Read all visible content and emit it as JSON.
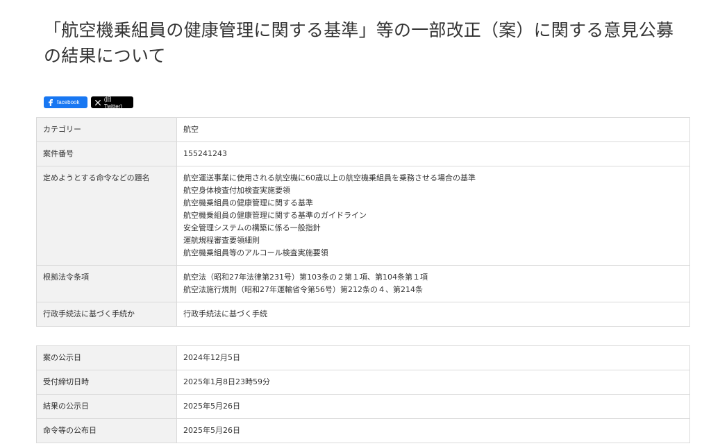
{
  "page": {
    "title": "「航空機乗組員の健康管理に関する基準」等の一部改正（案）に関する意見公募の結果について"
  },
  "share": {
    "facebook_label": "facebook",
    "x_label": "(旧Twitter)"
  },
  "details": {
    "category_label": "カテゴリー",
    "category_value": "航空",
    "case_number_label": "案件番号",
    "case_number_value": "155241243",
    "order_title_label": "定めようとする命令などの題名",
    "order_titles": [
      "航空運送事業に使用される航空機に60歳以上の航空機乗組員を乗務させる場合の基準",
      "航空身体検査付加検査実施要領",
      "航空機乗組員の健康管理に関する基準",
      "航空機乗組員の健康管理に関する基準のガイドライン",
      "安全管理システムの構築に係る一般指針",
      "運航規程審査要領細則",
      "航空機乗組員等のアルコール検査実施要領"
    ],
    "legal_basis_label": "根拠法令条項",
    "legal_basis": [
      "航空法（昭和27年法律第231号）第103条の２第１項、第104条第１項",
      "航空法施行規則（昭和27年運輸省令第56号）第212条の４、第214条"
    ],
    "procedure_label": "行政手続法に基づく手続か",
    "procedure_value": "行政手続法に基づく手続"
  },
  "dates": {
    "announce_label": "案の公示日",
    "announce_value": "2024年12月5日",
    "deadline_label": "受付締切日時",
    "deadline_value": "2025年1月8日23時59分",
    "result_label": "結果の公示日",
    "result_value": "2025年5月26日",
    "promulgation_label": "命令等の公布日",
    "promulgation_value": "2025年5月26日"
  }
}
